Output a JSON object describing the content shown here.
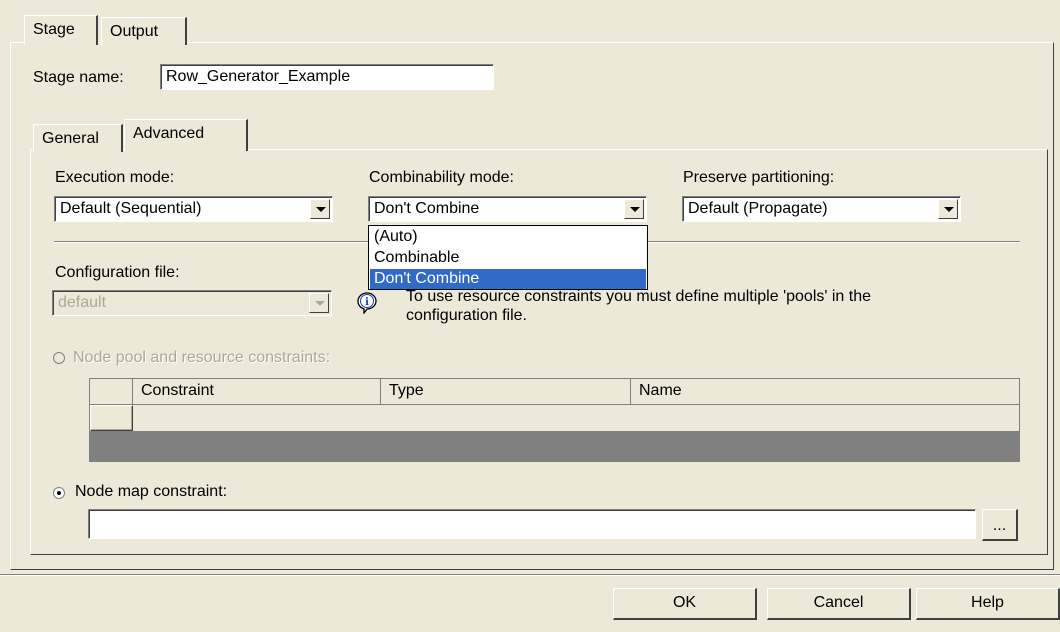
{
  "tabs_top": [
    {
      "label": "Stage"
    },
    {
      "label": "Output"
    }
  ],
  "stage_name": {
    "label": "Stage name:",
    "value": "Row_Generator_Example"
  },
  "tabs_inner": [
    {
      "label": "General"
    },
    {
      "label": "Advanced"
    }
  ],
  "execution_mode": {
    "label": "Execution mode:",
    "value": "Default (Sequential)"
  },
  "combinability_mode": {
    "label": "Combinability mode:",
    "value": "Don't Combine",
    "options": [
      "(Auto)",
      "Combinable",
      "Don't Combine"
    ],
    "selected_option": "Don't Combine"
  },
  "preserve_partitioning": {
    "label": "Preserve partitioning:",
    "value": "Default (Propagate)"
  },
  "configuration_file": {
    "label": "Configuration file:",
    "value": "default"
  },
  "info_text": "To use resource constraints you must define multiple 'pools' in the configuration file.",
  "node_pool": {
    "label": "Node pool and resource constraints:"
  },
  "grid": {
    "columns": [
      "Constraint",
      "Type",
      "Name"
    ]
  },
  "node_map": {
    "label": "Node map constraint:",
    "value": "",
    "browse_label": "..."
  },
  "buttons": {
    "ok": "OK",
    "cancel": "Cancel",
    "help": "Help"
  },
  "icons": {
    "info": "info-icon",
    "dropdown_arrow": "chevron-down-icon"
  },
  "colors": {
    "background": "#ece9d8",
    "selection": "#316ac5",
    "grid_empty": "#808080"
  }
}
